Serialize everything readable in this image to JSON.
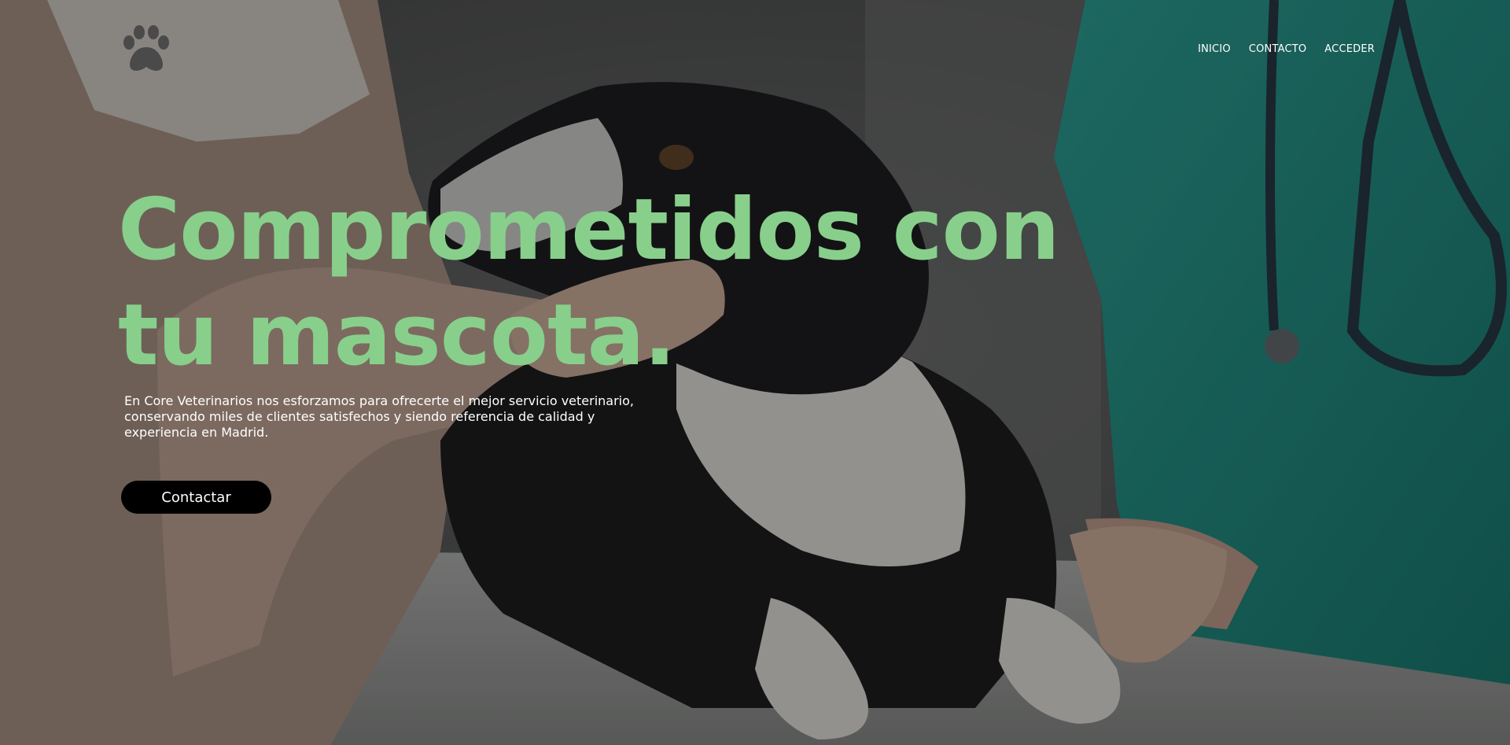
{
  "nav": {
    "items": [
      {
        "label": "INICIO"
      },
      {
        "label": "CONTACTO"
      },
      {
        "label": "ACCEDER"
      }
    ]
  },
  "hero": {
    "headline": "Comprometidos con tu mascota.",
    "description": "En Core Veterinarios nos esforzamos para ofrecerte el mejor servicio veterinario, conservando miles de clientes satisfechos y siendo referencia de calidad y experiencia en Madrid.",
    "cta_label": "Contactar"
  },
  "icons": {
    "logo": "paw-icon"
  },
  "colors": {
    "headline": "#88cf8b",
    "button_background": "#000000",
    "button_text": "#ffffff",
    "overlay": "#000000"
  }
}
